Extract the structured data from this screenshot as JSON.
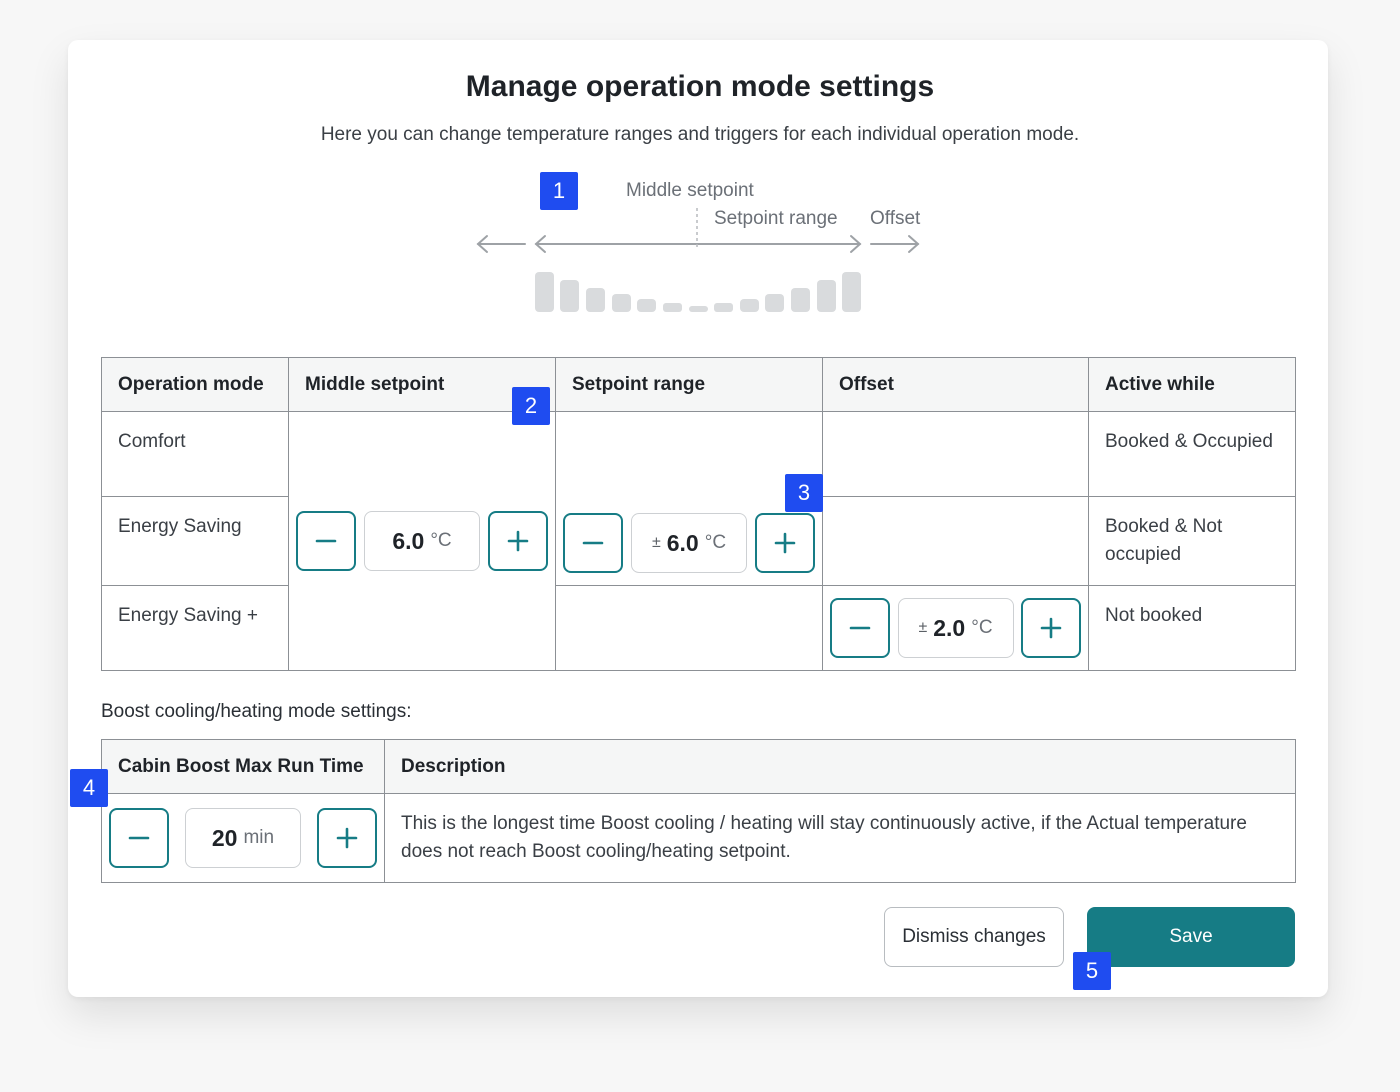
{
  "header": {
    "title": "Manage operation mode settings",
    "subtitle": "Here you can change temperature ranges and triggers for each individual operation mode."
  },
  "diagram": {
    "middle_setpoint_label": "Middle setpoint",
    "setpoint_range_label": "Setpoint range",
    "offset_label": "Offset"
  },
  "markers": [
    "1",
    "2",
    "3",
    "4",
    "5"
  ],
  "ops_table": {
    "headers": [
      "Operation mode",
      "Middle setpoint",
      "Setpoint range",
      "Offset",
      "Active while"
    ],
    "rows": [
      {
        "mode": "Comfort",
        "active_while": "Booked & Occupied"
      },
      {
        "mode": "Energy Saving",
        "active_while": "Booked & Not occupied"
      },
      {
        "mode": "Energy Saving +",
        "active_while": "Not booked"
      }
    ],
    "middle_setpoint": {
      "value": "6.0",
      "unit": "°C"
    },
    "setpoint_range": {
      "prefix": "±",
      "value": "6.0",
      "unit": "°C"
    },
    "offset": {
      "prefix": "±",
      "value": "2.0",
      "unit": "°C"
    }
  },
  "boost": {
    "section_label": "Boost cooling/heating mode settings:",
    "headers": [
      "Cabin Boost Max Run Time",
      "Description"
    ],
    "run_time": {
      "value": "20",
      "unit": "min"
    },
    "description": "This is the longest time Boost cooling / heating will stay continuously active, if the Actual temperature does not reach Boost cooling/heating setpoint."
  },
  "actions": {
    "dismiss_label": "Dismiss changes",
    "save_label": "Save"
  },
  "colors": {
    "accent": "#167c85",
    "marker": "#1f4cf0"
  },
  "icons": [
    "minus-icon",
    "plus-icon"
  ]
}
